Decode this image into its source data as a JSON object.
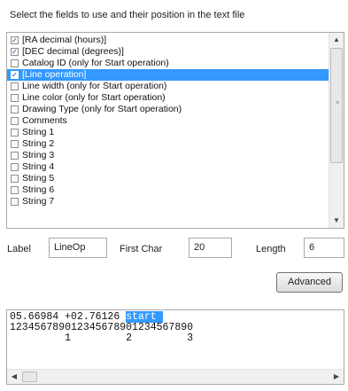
{
  "instructions": "Select the fields to use and their position in the text file",
  "fields": [
    {
      "label": "[RA decimal (hours)]",
      "checked": true,
      "selected": false
    },
    {
      "label": "[DEC decimal (degrees)]",
      "checked": true,
      "selected": false
    },
    {
      "label": "Catalog ID (only for Start operation)",
      "checked": false,
      "selected": false
    },
    {
      "label": "[Line operation]",
      "checked": true,
      "selected": true
    },
    {
      "label": "Line width (only for Start operation)",
      "checked": false,
      "selected": false
    },
    {
      "label": "Line color (only for Start operation)",
      "checked": false,
      "selected": false
    },
    {
      "label": "Drawing Type (only for Start operation)",
      "checked": false,
      "selected": false
    },
    {
      "label": "Comments",
      "checked": false,
      "selected": false
    },
    {
      "label": "String 1",
      "checked": false,
      "selected": false
    },
    {
      "label": "String 2",
      "checked": false,
      "selected": false
    },
    {
      "label": "String 3",
      "checked": false,
      "selected": false
    },
    {
      "label": "String 4",
      "checked": false,
      "selected": false
    },
    {
      "label": "String 5",
      "checked": false,
      "selected": false
    },
    {
      "label": "String 6",
      "checked": false,
      "selected": false
    },
    {
      "label": "String 7",
      "checked": false,
      "selected": false
    }
  ],
  "label_caption": "Label",
  "label_value": "LineOp",
  "first_char_caption": "First Char",
  "first_char_value": "20",
  "length_caption": "Length",
  "length_value": "6",
  "advanced_label": "Advanced",
  "preview": {
    "line1_pre": "05.66984 +02.76126 ",
    "line1_highlight": "start ",
    "line2": "123456789012345678901234567890",
    "line3": "         1         2         3"
  },
  "icons": {
    "scroll_up": "scroll-up-arrow-icon",
    "scroll_down": "scroll-down-arrow-icon",
    "scroll_left": "scroll-left-arrow-icon",
    "scroll_right": "scroll-right-arrow-icon"
  },
  "colors": {
    "selection": "#3399ff"
  }
}
